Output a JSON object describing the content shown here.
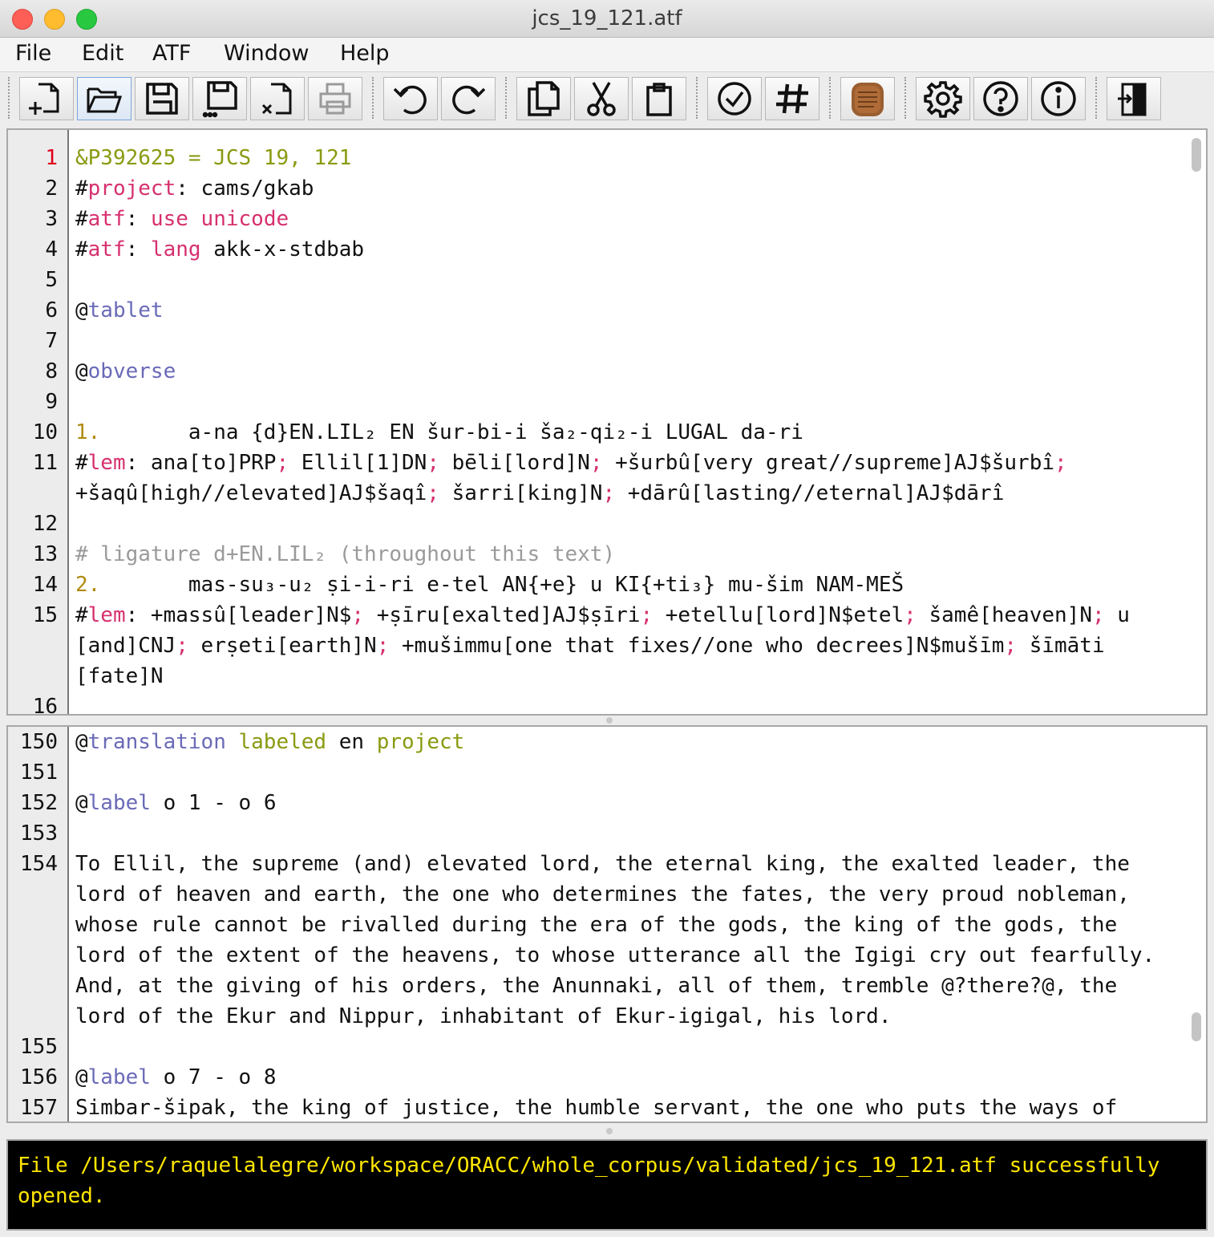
{
  "window": {
    "title": "jcs_19_121.atf"
  },
  "menu": [
    "File",
    "Edit",
    "ATF",
    "Window",
    "Help"
  ],
  "toolbar": {
    "buttons": [
      {
        "name": "new-file-icon"
      },
      {
        "name": "open-folder-icon"
      },
      {
        "name": "save-icon"
      },
      {
        "name": "save-as-icon"
      },
      {
        "name": "close-file-icon"
      },
      {
        "name": "print-icon"
      },
      {
        "name": "undo-icon"
      },
      {
        "name": "redo-icon"
      },
      {
        "name": "copy-icon"
      },
      {
        "name": "cut-icon"
      },
      {
        "name": "paste-icon"
      },
      {
        "name": "validate-check-icon"
      },
      {
        "name": "lemmatise-hash-icon"
      },
      {
        "name": "tablet-icon"
      },
      {
        "name": "settings-gear-icon"
      },
      {
        "name": "help-question-icon"
      },
      {
        "name": "info-icon"
      },
      {
        "name": "exit-door-icon"
      }
    ]
  },
  "editor_top": {
    "lines": [
      {
        "n": "1",
        "current": true,
        "segs": [
          [
            "&P392625 = JCS 19, 121",
            "olive"
          ]
        ]
      },
      {
        "n": "2",
        "segs": [
          [
            "#",
            ""
          ],
          [
            "project",
            "pink"
          ],
          [
            ": cams/gkab",
            ""
          ]
        ]
      },
      {
        "n": "3",
        "segs": [
          [
            "#",
            ""
          ],
          [
            "atf",
            "pink"
          ],
          [
            ": ",
            ""
          ],
          [
            "use unicode",
            "pink"
          ]
        ]
      },
      {
        "n": "4",
        "segs": [
          [
            "#",
            ""
          ],
          [
            "atf",
            "pink"
          ],
          [
            ": ",
            ""
          ],
          [
            "lang",
            "pink"
          ],
          [
            " akk-x-stdbab",
            ""
          ]
        ]
      },
      {
        "n": "5",
        "segs": []
      },
      {
        "n": "6",
        "segs": [
          [
            "@",
            ""
          ],
          [
            "tablet",
            "blue"
          ]
        ]
      },
      {
        "n": "7",
        "segs": []
      },
      {
        "n": "8",
        "segs": [
          [
            "@",
            ""
          ],
          [
            "obverse",
            "blue"
          ]
        ]
      },
      {
        "n": "9",
        "segs": []
      },
      {
        "n": "10",
        "segs": [
          [
            "1.",
            "gold"
          ],
          [
            "       a-na {d}EN.LIL₂ EN šur-bi-i ša₂-qi₂-i LUGAL da-ri",
            ""
          ]
        ]
      },
      {
        "n": "11",
        "segs": [
          [
            "#",
            ""
          ],
          [
            "lem",
            "pink"
          ],
          [
            ": ana[to]PRP",
            ""
          ],
          [
            "; ",
            "pink"
          ],
          [
            "Ellil[1]DN",
            ""
          ],
          [
            "; ",
            "pink"
          ],
          [
            "bēli[lord]N",
            ""
          ],
          [
            "; ",
            "pink"
          ],
          [
            "+šurbû[very great//supreme]AJ$šurbî",
            ""
          ],
          [
            "; ",
            "pink"
          ],
          [
            "+šaqû[high//elevated]AJ$šaqî",
            ""
          ],
          [
            "; ",
            "pink"
          ],
          [
            "šarri[king]N",
            ""
          ],
          [
            "; ",
            "pink"
          ],
          [
            "+dārû[lasting//eternal]AJ$dārî",
            ""
          ]
        ]
      },
      {
        "n": "12",
        "segs": []
      },
      {
        "n": "13",
        "segs": [
          [
            "# ligature d+EN.LIL₂ (throughout this text)",
            "gray"
          ]
        ]
      },
      {
        "n": "14",
        "segs": [
          [
            "2.",
            "gold"
          ],
          [
            "       mas-su₃-u₂ ṣi-i-ri e-tel AN{+e} u KI{+ti₃} mu-šim NAM-MEŠ",
            ""
          ]
        ]
      },
      {
        "n": "15",
        "segs": [
          [
            "#",
            ""
          ],
          [
            "lem",
            "pink"
          ],
          [
            ": +massû[leader]N$",
            ""
          ],
          [
            "; ",
            "pink"
          ],
          [
            "+ṣīru[exalted]AJ$ṣīri",
            ""
          ],
          [
            "; ",
            "pink"
          ],
          [
            "+etellu[lord]N$etel",
            ""
          ],
          [
            "; ",
            "pink"
          ],
          [
            "šamê[heaven]N",
            ""
          ],
          [
            "; ",
            "pink"
          ],
          [
            "u [and]CNJ",
            ""
          ],
          [
            "; ",
            "pink"
          ],
          [
            "erṣeti[earth]N",
            ""
          ],
          [
            "; ",
            "pink"
          ],
          [
            "+mušimmu[one that fixes//one who decrees]N$mušīm",
            ""
          ],
          [
            "; ",
            "pink"
          ],
          [
            "šīmāti [fate]N",
            ""
          ]
        ]
      },
      {
        "n": "16",
        "segs": []
      }
    ]
  },
  "editor_bottom": {
    "lines": [
      {
        "n": "150",
        "segs": [
          [
            "@",
            ""
          ],
          [
            "translation",
            "blue"
          ],
          [
            " ",
            ""
          ],
          [
            "labeled",
            "olive"
          ],
          [
            " en ",
            ""
          ],
          [
            "project",
            "olive"
          ]
        ]
      },
      {
        "n": "151",
        "segs": []
      },
      {
        "n": "152",
        "segs": [
          [
            "@",
            ""
          ],
          [
            "label",
            "blue"
          ],
          [
            " o 1 - o 6",
            ""
          ]
        ]
      },
      {
        "n": "153",
        "segs": []
      },
      {
        "n": "154",
        "segs": [
          [
            "To Ellil, the supreme (and) elevated lord, the eternal king, the exalted leader, the lord of heaven and earth, the one who determines the fates, the very proud nobleman, whose rule cannot be rivalled during the era of the gods, the king of the gods, the lord of the extent of the heavens, to whose utterance all the Igigi cry out fearfully. And, at the giving of his orders, the Anunnaki, all of them, tremble @?there?@, the lord of the Ekur and Nippur, inhabitant of Ekur-igigal, his lord.",
            ""
          ]
        ]
      },
      {
        "n": "155",
        "segs": []
      },
      {
        "n": "156",
        "segs": [
          [
            "@",
            ""
          ],
          [
            "label",
            "blue"
          ],
          [
            " o 7 - o 8",
            ""
          ]
        ]
      },
      {
        "n": "157",
        "segs": [
          [
            "Simbar-šipak, the king of justice, the humble servant, the one who puts the ways of",
            ""
          ]
        ]
      }
    ]
  },
  "console": {
    "message": "File /Users/raquelalegre/workspace/ORACC/whole_corpus/validated/jcs_19_121.atf successfully opened."
  }
}
